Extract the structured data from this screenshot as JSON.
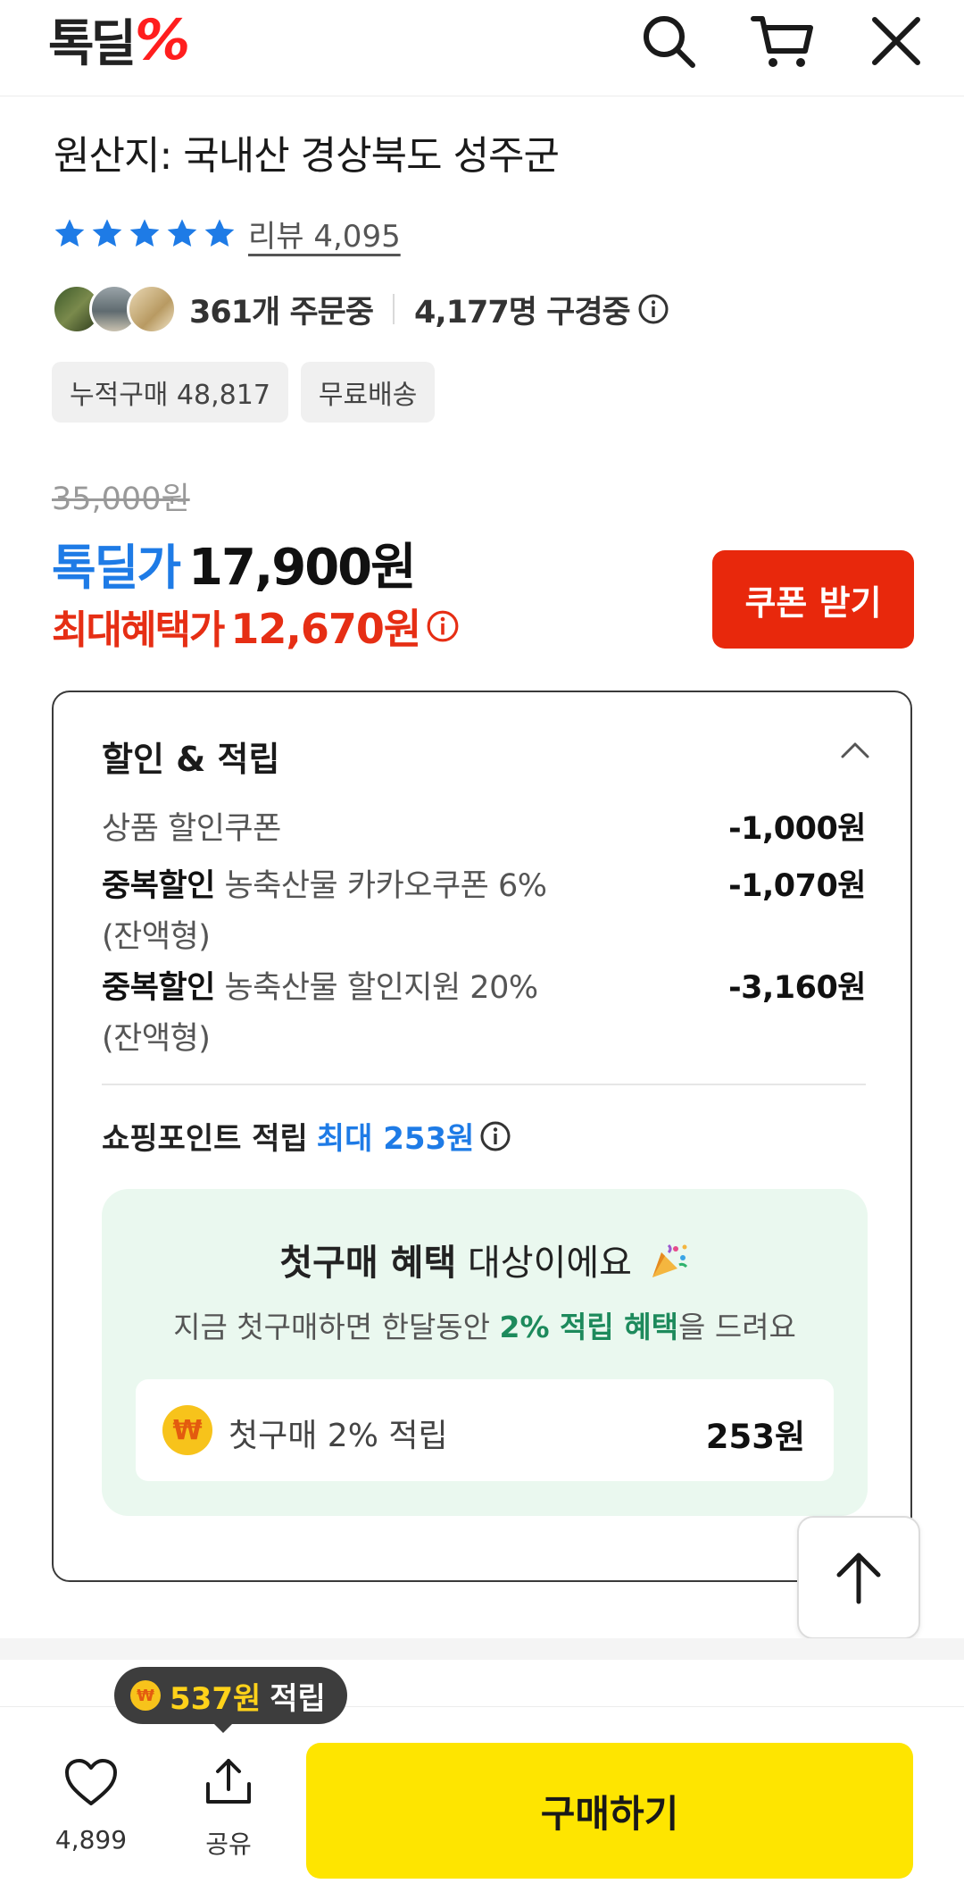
{
  "header": {
    "logo_text": "톡딜",
    "logo_mark": "%"
  },
  "product": {
    "origin": "원산지: 국내산 경상북도 성주군",
    "review_label": "리뷰 4,095",
    "rating_stars": 5,
    "orders_text": "361개 주문중",
    "viewers_text": "4,177명 구경중",
    "chips": [
      "누적구매 48,817",
      "무료배송"
    ]
  },
  "price": {
    "original": "35,000원",
    "deal_label": "톡딜가",
    "deal_price": "17,900원",
    "max_label": "최대혜택가",
    "max_price": "12,670원",
    "coupon_button": "쿠폰 받기"
  },
  "discount": {
    "title": "할인 & 적립",
    "lines": [
      {
        "tag": "",
        "text": "상품 할인쿠폰",
        "sub": "",
        "amount": "-1,000원"
      },
      {
        "tag": "중복할인",
        "text": "농축산물 카카오쿠폰 6%",
        "sub": "(잔액형)",
        "amount": "-1,070원"
      },
      {
        "tag": "중복할인",
        "text": "농축산물 할인지원 20%",
        "sub": "(잔액형)",
        "amount": "-3,160원"
      }
    ],
    "points_label": "쇼핑포인트 적립",
    "points_value": "최대 253원",
    "first": {
      "title_bold": "첫구매 혜택",
      "title_rest": "대상이에요",
      "sub_pre": "지금 첫구매하면 한달동안",
      "sub_bold": "2% 적립 혜택",
      "sub_post": "을 드려요",
      "item_label": "첫구매 2% 적립",
      "item_amount": "253원"
    }
  },
  "bottom": {
    "like_count": "4,899",
    "share_label": "공유",
    "buy_label": "구매하기",
    "tooltip_amount": "537원",
    "tooltip_text": "적립"
  }
}
